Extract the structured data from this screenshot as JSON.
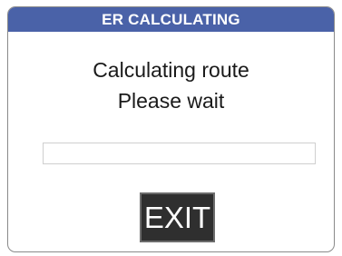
{
  "dialog": {
    "title": "ER CALCULATING",
    "message_line1": "Calculating route",
    "message_line2": "Please wait",
    "progress": 0,
    "exit_label": "EXIT"
  },
  "colors": {
    "titlebar": "#4a62a8",
    "button_bg": "#2f2f2f"
  }
}
